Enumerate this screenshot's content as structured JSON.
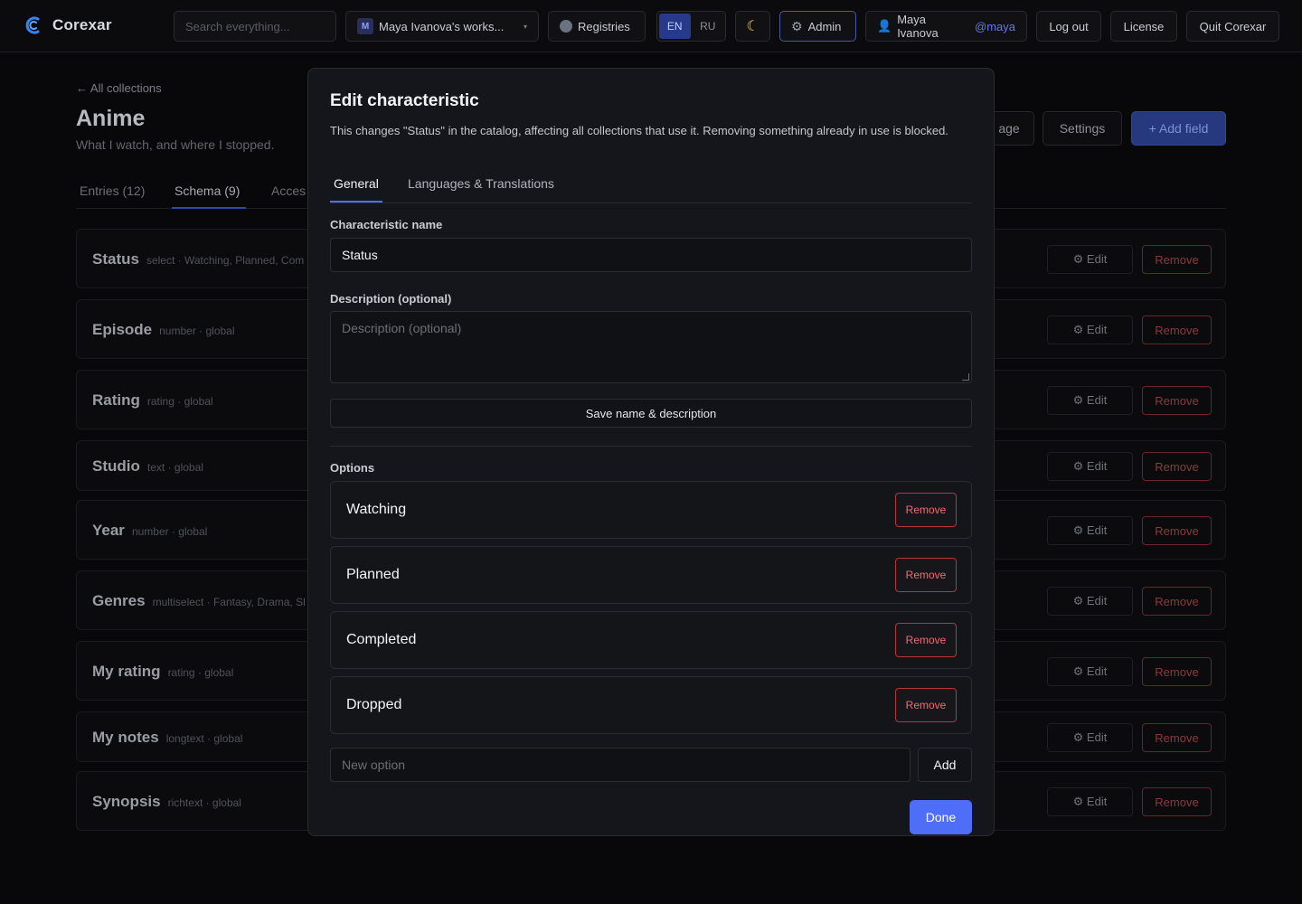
{
  "app": {
    "name": "Corexar",
    "search_placeholder": "Search everything...",
    "workspace": {
      "badge": "M",
      "label": "Maya Ivanova's works..."
    },
    "registries": "Registries",
    "languages": [
      "EN",
      "RU"
    ],
    "active_language": "EN",
    "theme_icon": "moon-icon",
    "admin": "Admin",
    "user": {
      "name": "Maya Ivanova",
      "handle": "@maya"
    },
    "logout": "Log out",
    "license": "License",
    "quit": "Quit Corexar"
  },
  "page": {
    "back_link": "← All collections",
    "title": "Anime",
    "subtitle": "What I watch, and where I stopped.",
    "tabs": [
      "Entries (12)",
      "Schema (9)",
      "Acces"
    ],
    "active_tab": "Schema (9)",
    "buttons": {
      "manage": "age",
      "settings": "Settings",
      "add_field": "+ Add field"
    },
    "edit_label": "⚙ Edit",
    "remove_label": "Remove",
    "fields": [
      {
        "name": "Status",
        "meta": "select · Watching, Planned, Com"
      },
      {
        "name": "Episode",
        "meta": "number · global"
      },
      {
        "name": "Rating",
        "meta": "rating · global"
      },
      {
        "name": "Studio",
        "meta": "text · global"
      },
      {
        "name": "Year",
        "meta": "number · global"
      },
      {
        "name": "Genres",
        "meta": "multiselect · Fantasy, Drama, Sl"
      },
      {
        "name": "My rating",
        "meta": "rating · global"
      },
      {
        "name": "My notes",
        "meta": "longtext · global"
      },
      {
        "name": "Synopsis",
        "meta": "richtext · global"
      }
    ]
  },
  "modal": {
    "title": "Edit characteristic",
    "description": "This changes \"Status\" in the catalog, affecting all collections that use it. Removing something already in use is blocked.",
    "tabs": [
      "General",
      "Languages & Translations"
    ],
    "active_tab": "General",
    "name_label": "Characteristic name",
    "name_value": "Status",
    "desc_label": "Description (optional)",
    "desc_placeholder": "Description (optional)",
    "save_button": "Save name & description",
    "options_label": "Options",
    "options": [
      "Watching",
      "Planned",
      "Completed",
      "Dropped"
    ],
    "remove_label": "Remove",
    "new_option_placeholder": "New option",
    "add_button": "Add",
    "done_button": "Done"
  },
  "colors": {
    "accent": "#4f6ef7",
    "danger": "#f26b72",
    "surface": "#15161b"
  }
}
